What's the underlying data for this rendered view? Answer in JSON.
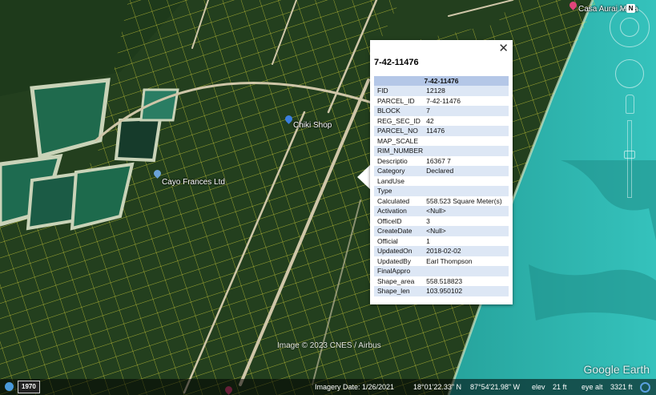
{
  "map": {
    "labels": {
      "top_right_place": "Casa Aurai Mara",
      "shop": "Chiki Shop",
      "business": "Cayo Frances Ltd"
    },
    "copyright": "Image © 2023 CNES / Airbus",
    "brand": "Google Earth"
  },
  "navigation": {
    "north": "N"
  },
  "popup": {
    "close_label": "✕",
    "title": "7-42-11476",
    "table_header": "7-42-11476",
    "rows": [
      {
        "key": "FID",
        "value": "12128"
      },
      {
        "key": "PARCEL_ID",
        "value": "7-42-11476"
      },
      {
        "key": "BLOCK",
        "value": "7"
      },
      {
        "key": "REG_SEC_ID",
        "value": "42"
      },
      {
        "key": "PARCEL_NO",
        "value": "11476"
      },
      {
        "key": "MAP_SCALE",
        "value": ""
      },
      {
        "key": "RIM_NUMBER",
        "value": ""
      },
      {
        "key": "Descriptio",
        "value": "16367 7"
      },
      {
        "key": "Category",
        "value": "Declared"
      },
      {
        "key": "LandUse",
        "value": ""
      },
      {
        "key": "Type",
        "value": ""
      },
      {
        "key": "Calculated",
        "value": "558.523 Square Meter(s)"
      },
      {
        "key": "Activation",
        "value": "<Null>"
      },
      {
        "key": "OfficeID",
        "value": "3"
      },
      {
        "key": "CreateDate",
        "value": "<Null>"
      },
      {
        "key": "Official",
        "value": "1"
      },
      {
        "key": "UpdatedOn",
        "value": "2018-02-02"
      },
      {
        "key": "UpdatedBy",
        "value": "Earl Thompson"
      },
      {
        "key": "FinalAppro",
        "value": ""
      },
      {
        "key": "Shape_area",
        "value": "558.518823"
      },
      {
        "key": "Shape_len",
        "value": "103.950102"
      }
    ]
  },
  "status": {
    "year": "1970",
    "imagery_date": "Imagery Date: 1/26/2021",
    "lat": "18°01'22.33\" N",
    "lon": "87°54'21.98\" W",
    "elev": "elev",
    "elev_value": "21 ft",
    "eye_alt": "eye alt",
    "eye_alt_value": "3321 ft"
  },
  "colors": {
    "parcel_lines": "#e8e23a",
    "sea": "#2fb7b0",
    "land": "#233f1e",
    "popup_header": "#b4c7e7",
    "popup_stripe": "#dde7f5",
    "pin_blue": "#3b7fe0",
    "pin_pink": "#e0457b"
  }
}
